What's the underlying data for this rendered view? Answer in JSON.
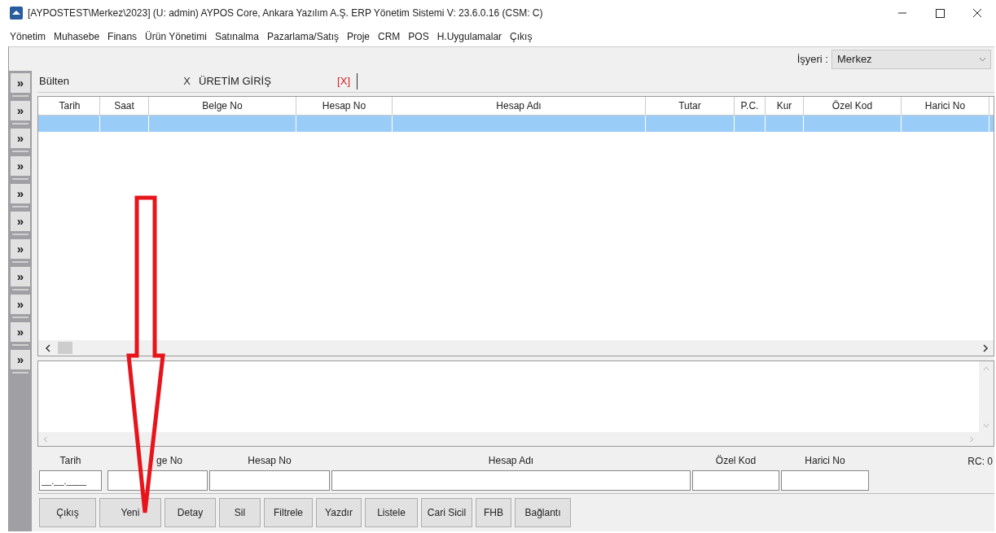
{
  "window": {
    "title": "[AYPOSTEST\\Merkez\\2023] (U: admin) AYPOS Core, Ankara Yazılım A.Ş. ERP Yönetim Sistemi V: 23.6.0.16 (CSM: C)"
  },
  "menu": [
    "Yönetim",
    "Muhasebe",
    "Finans",
    "Ürün Yönetimi",
    "Satınalma",
    "Pazarlama/Satış",
    "Proje",
    "CRM",
    "POS",
    "H.Uygulamalar",
    "Çıkış"
  ],
  "workplace": {
    "label": "İşyeri :",
    "value": "Merkez"
  },
  "sidebar": {
    "buttons": [
      "»",
      "»",
      "»",
      "»",
      "»",
      "»",
      "»",
      "»",
      "»",
      "»",
      "»"
    ]
  },
  "tabs": [
    {
      "label": "Bülten",
      "close": "X",
      "color": "#333333"
    },
    {
      "label": "ÜRETİM GİRİŞ",
      "close": "[X]",
      "color": "#d42020"
    }
  ],
  "grid": {
    "columns": [
      "Tarih",
      "Saat",
      "Belge No",
      "Hesap No",
      "Hesap Adı",
      "Tutar",
      "P.C.",
      "Kur",
      "Özel Kod",
      "Harici No"
    ],
    "rows": [
      {
        "selected": true
      }
    ]
  },
  "filters": [
    {
      "label": "Tarih",
      "value": "__.__.____"
    },
    {
      "label": "ge No"
    },
    {
      "label": "Hesap No"
    },
    {
      "label": "Hesap Adı"
    },
    {
      "label": "Özel Kod"
    },
    {
      "label": "Harici No"
    }
  ],
  "record_count": "RC: 0",
  "buttons": [
    "Çıkış",
    "Yeni",
    "Detay",
    "Sil",
    "Filtrele",
    "Yazdır",
    "Listele",
    "Cari Sicil",
    "FHB",
    "Bağlantı"
  ]
}
